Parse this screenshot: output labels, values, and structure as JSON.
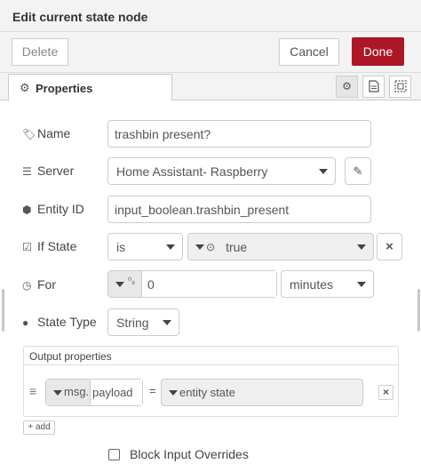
{
  "dialog": {
    "title": "Edit current state node"
  },
  "toolbar": {
    "delete_label": "Delete",
    "cancel_label": "Cancel",
    "done_label": "Done"
  },
  "tabs": {
    "properties_label": "Properties",
    "properties_icon": "gear-icon"
  },
  "tab_actions": [
    "settings-icon",
    "description-icon",
    "appearance-icon"
  ],
  "form": {
    "name": {
      "label": "Name",
      "value": "trashbin present?"
    },
    "server": {
      "label": "Server",
      "value": "Home Assistant- Raspberry"
    },
    "entity_id": {
      "label": "Entity ID",
      "value": "input_boolean.trashbin_present"
    },
    "if_state": {
      "label": "If State",
      "operator": "is",
      "type_icon": "⊙",
      "value": "true"
    },
    "for": {
      "label": "For",
      "type_glyph": "⁰₉",
      "value": "0",
      "unit": "minutes"
    },
    "state_type": {
      "label": "State Type",
      "value": "String"
    }
  },
  "output": {
    "title": "Output properties",
    "rows": [
      {
        "prop_type": "msg.",
        "prop_value": "payload",
        "operator": "=",
        "value_type": "entity state"
      }
    ],
    "add_label": "add"
  },
  "block_input": {
    "label": "Block Input Overrides",
    "checked": false
  }
}
